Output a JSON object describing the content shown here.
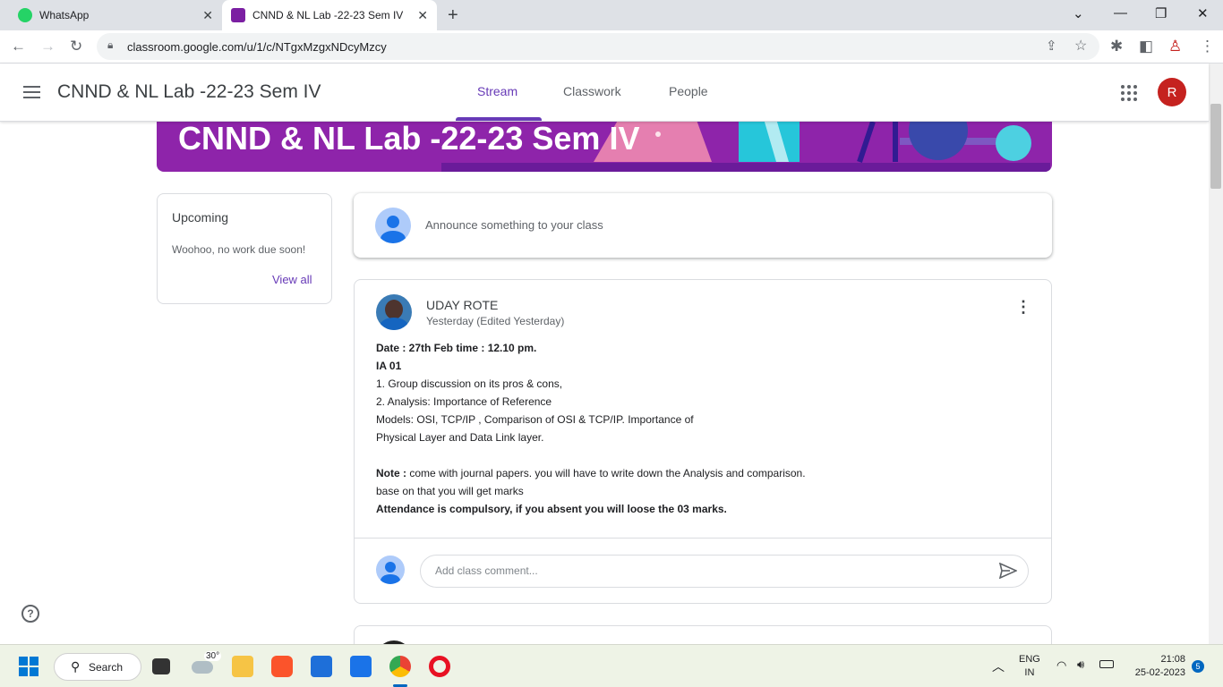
{
  "browser": {
    "tabs": [
      {
        "title": "WhatsApp"
      },
      {
        "title": "CNND & NL Lab -22-23 Sem IV"
      }
    ],
    "url": "classroom.google.com/u/1/c/NTgxMzgxNDcyMzcy"
  },
  "header": {
    "class_title": "CNND & NL Lab -22-23 Sem IV",
    "tabs": [
      "Stream",
      "Classwork",
      "People"
    ],
    "active_tab": "Stream",
    "avatar_letter": "R"
  },
  "banner": {
    "title": "CNND & NL Lab -22-23 Sem IV"
  },
  "upcoming": {
    "title": "Upcoming",
    "text": "Woohoo, no work due soon!",
    "link": "View all"
  },
  "announce": {
    "placeholder": "Announce something to your class"
  },
  "post": {
    "author": "UDAY ROTE",
    "time": "Yesterday (Edited Yesterday)",
    "line1": "Date : 27th Feb time : 12.10 pm.",
    "line2": "IA 01",
    "line3": "1. Group discussion on its pros & cons,",
    "line4": "2.  Analysis:  Importance of Reference",
    "line5": "Models: OSI, TCP/IP , Comparison of OSI & TCP/IP. Importance of",
    "line6": "Physical Layer and Data Link layer.",
    "note_label": "Note :",
    "note_text": " come with journal papers. you will have to write down the Analysis and comparison.",
    "line8": "base on that you will get marks",
    "line9": "Attendance is compulsory, if you absent you will loose the 03 marks.",
    "comment_placeholder": "Add class comment..."
  },
  "taskbar": {
    "search_label": "Search",
    "weather": "30°",
    "lang1": "ENG",
    "lang2": "IN",
    "time": "21:08",
    "date": "25-02-2023",
    "notifications": "5"
  },
  "colors": {
    "accent": "#673ab7",
    "banner": "#8e24aa",
    "avatar": "#c5221f"
  }
}
